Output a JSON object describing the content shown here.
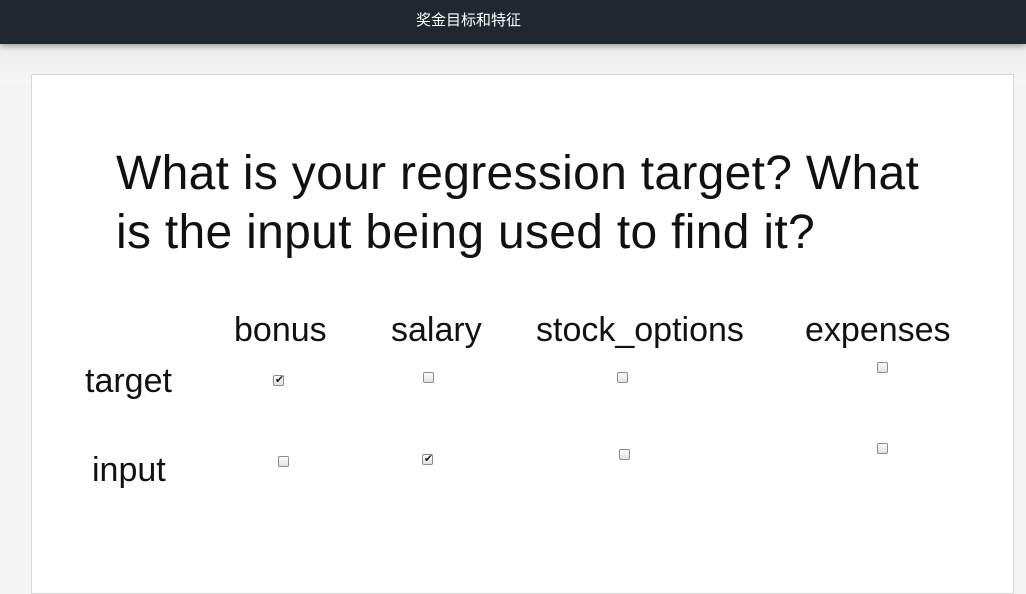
{
  "header": {
    "title": "奖金目标和特征"
  },
  "slide": {
    "question_line1": "What is your regression target?  What",
    "question_line2": "is the input being used to find it?",
    "columns": [
      "bonus",
      "salary",
      "stock_options",
      "expenses"
    ],
    "rows": [
      {
        "label": "target",
        "checked": [
          true,
          false,
          false,
          false
        ]
      },
      {
        "label": "input",
        "checked": [
          false,
          true,
          false,
          false
        ]
      }
    ],
    "check_glyph": "✔"
  }
}
